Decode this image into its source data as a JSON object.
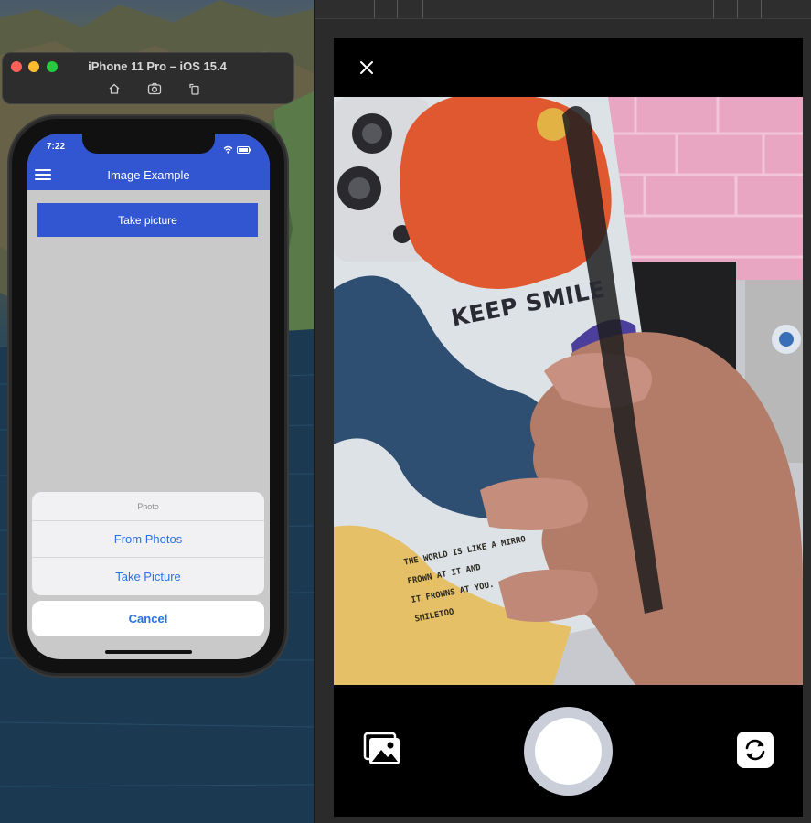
{
  "simulator": {
    "title": "iPhone 11 Pro – iOS 15.4",
    "tools": [
      "home-icon",
      "screenshot-icon",
      "rotate-icon"
    ]
  },
  "app": {
    "status_time": "7:22",
    "nav_title": "Image Example",
    "take_picture_label": "Take picture",
    "accent_color": "#3255d1"
  },
  "action_sheet": {
    "title": "Photo",
    "options": [
      "From Photos",
      "Take Picture"
    ],
    "cancel_label": "Cancel",
    "option_color": "#2871e6"
  },
  "camera": {
    "controls": [
      "close-icon",
      "gallery-icon",
      "shutter-button",
      "flip-camera-icon"
    ],
    "scene_text": {
      "headline": "KEEP SMILE",
      "lines": [
        "THE WORLD IS LIKE A MIRRO",
        "FROWN AT IT AND",
        "IT FROWNS AT YOU.",
        "SMILETOO"
      ]
    }
  }
}
